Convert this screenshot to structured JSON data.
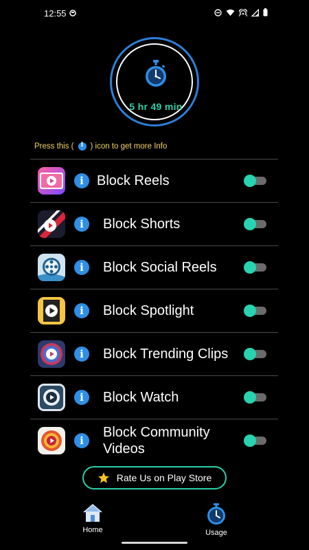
{
  "status_bar": {
    "time": "12:55"
  },
  "timer": {
    "usage_text": "5 hr 49 min"
  },
  "hint": {
    "before": "Press this (",
    "after": ") icon to get more Info"
  },
  "list": {
    "items": [
      {
        "label": "Block Reels",
        "enabled": true
      },
      {
        "label": "Block Shorts",
        "enabled": true
      },
      {
        "label": "Block Social Reels",
        "enabled": true
      },
      {
        "label": "Block Spotlight",
        "enabled": true
      },
      {
        "label": "Block Trending Clips",
        "enabled": true
      },
      {
        "label": "Block Watch",
        "enabled": true
      },
      {
        "label": "Block Community Videos",
        "enabled": true
      }
    ]
  },
  "rate_button": {
    "label": "Rate Us on Play Store"
  },
  "bottom_nav": {
    "home_label": "Home",
    "usage_label": "Usage"
  },
  "colors": {
    "accent_teal": "#2ecfa8",
    "accent_blue": "#2f8fe6",
    "hint_yellow": "#f3d56a"
  }
}
